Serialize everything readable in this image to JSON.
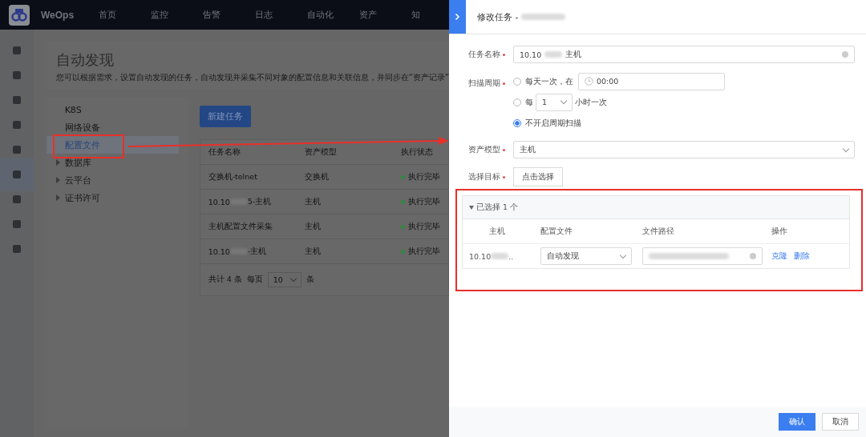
{
  "topbar": {
    "logo": "WeOps",
    "nav": [
      {
        "label": "首页"
      },
      {
        "label": "监控"
      },
      {
        "label": "告警"
      },
      {
        "label": "日志"
      },
      {
        "label": "自动化"
      },
      {
        "label": "资产"
      },
      {
        "label": "知"
      }
    ]
  },
  "page": {
    "title": "自动发现",
    "description": "您可以根据需求，设置自动发现的任务，自动发现并采集不同对象的配置信息和关联信息，并同步在“资产记录”"
  },
  "categories": [
    {
      "label": "K8S",
      "kind": "leaf",
      "selected": false
    },
    {
      "label": "网络设备",
      "kind": "leaf",
      "selected": false
    },
    {
      "label": "配置文件",
      "kind": "leaf",
      "selected": true
    },
    {
      "label": "数据库",
      "kind": "group",
      "selected": false
    },
    {
      "label": "云平台",
      "kind": "group",
      "selected": false
    },
    {
      "label": "证书许可",
      "kind": "group",
      "selected": false
    }
  ],
  "new_task_button": "新建任务",
  "table": {
    "columns": [
      "任务名称",
      "资产模型",
      "执行状态"
    ],
    "rows": [
      {
        "name_parts": [
          "交换机-telnet"
        ],
        "model": "交换机",
        "status": "执行完毕"
      },
      {
        "name_parts": [
          "10.10",
          "5-主机"
        ],
        "model": "主机",
        "status": "执行完毕"
      },
      {
        "name_parts": [
          "主机配置文件采集"
        ],
        "model": "主机",
        "status": "执行完毕"
      },
      {
        "name_parts": [
          "10.10",
          "-主机"
        ],
        "model": "主机",
        "status": "执行完毕"
      }
    ]
  },
  "pagination": {
    "total": "共计 4 条",
    "per_page_label": "每页",
    "per_page": "10",
    "unit": "条"
  },
  "drawer": {
    "title": "修改任务 -",
    "task_name": {
      "label": "任务名称",
      "required": true,
      "value_parts": [
        "10.10",
        "主机"
      ]
    },
    "scan_period": {
      "label": "扫描周期",
      "required": true,
      "options": [
        {
          "kind": "daily",
          "label": "每天一次，在",
          "time": "00:00",
          "selected": false
        },
        {
          "kind": "hourly",
          "label": "每",
          "hours": "1",
          "suffix": "小时一次",
          "selected": false
        },
        {
          "kind": "none",
          "label": "不开启周期扫描",
          "selected": true
        }
      ]
    },
    "asset_model": {
      "label": "资产模型",
      "required": true,
      "value": "主机"
    },
    "target": {
      "label": "选择目标",
      "required": true,
      "button": "点击选择"
    },
    "selected_panel": {
      "title": "已选择 1 个",
      "expanded": true,
      "columns": [
        "主机",
        "配置文件",
        "文件路径",
        "操作"
      ],
      "rows": [
        {
          "host": "10.10",
          "host_end": "..",
          "config": "自动发现",
          "actions": [
            "克隆",
            "删除"
          ]
        }
      ]
    },
    "buttons": [
      "确认",
      "取消"
    ]
  }
}
